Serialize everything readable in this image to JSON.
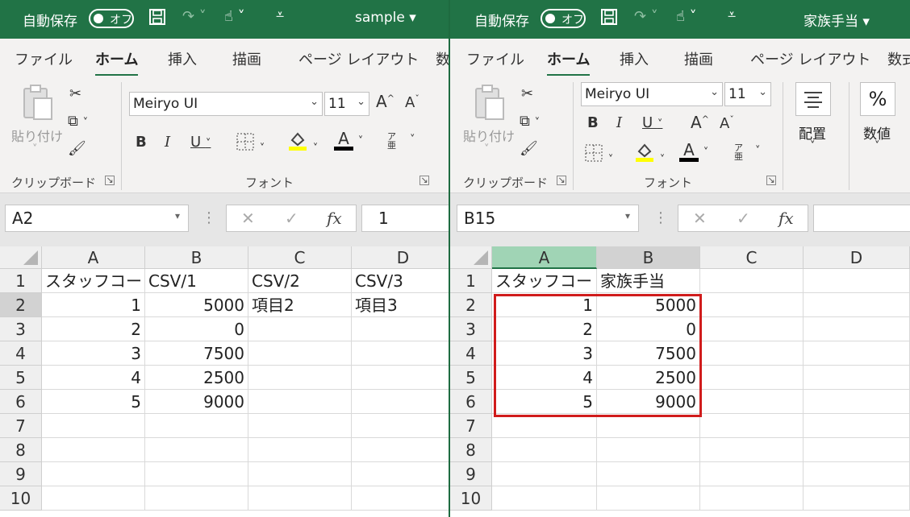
{
  "window1": {
    "autosave_label": "自動保存",
    "autosave_state": "オフ",
    "doc_title": "sample",
    "tabs": [
      "ファイル",
      "ホーム",
      "挿入",
      "描画",
      "ページ レイアウト",
      "数"
    ],
    "clipboard": {
      "paste_label": "貼り付け",
      "group_label": "クリップボード"
    },
    "font": {
      "name": "Meiryo UI",
      "size": "11",
      "group_label": "フォント"
    },
    "name_box": "A2",
    "formula_value": "1",
    "columns": [
      "A",
      "B",
      "C",
      "D"
    ],
    "row_numbers": [
      "1",
      "2",
      "3",
      "4",
      "5",
      "6",
      "7",
      "8",
      "9",
      "10"
    ],
    "rows": [
      [
        "スタッフコード",
        "CSV/1",
        "CSV/2",
        "CSV/3"
      ],
      [
        "1",
        "5000",
        "項目2",
        "項目3"
      ],
      [
        "2",
        "0",
        "",
        ""
      ],
      [
        "3",
        "7500",
        "",
        ""
      ],
      [
        "4",
        "2500",
        "",
        ""
      ],
      [
        "5",
        "9000",
        "",
        ""
      ]
    ]
  },
  "window2": {
    "autosave_label": "自動保存",
    "autosave_state": "オフ",
    "doc_title": "家族手当",
    "tabs": [
      "ファイル",
      "ホーム",
      "挿入",
      "描画",
      "ページ レイアウト",
      "数式"
    ],
    "clipboard": {
      "paste_label": "貼り付け",
      "group_label": "クリップボード"
    },
    "font": {
      "name": "Meiryo UI",
      "size": "11",
      "group_label": "フォント"
    },
    "alignment_label": "配置",
    "number_label": "数値",
    "name_box": "B15",
    "columns": [
      "A",
      "B",
      "C",
      "D"
    ],
    "row_numbers": [
      "1",
      "2",
      "3",
      "4",
      "5",
      "6",
      "7",
      "8",
      "9",
      "10"
    ],
    "rows": [
      [
        "スタッフコード",
        "家族手当",
        "",
        ""
      ],
      [
        "1",
        "5000",
        "",
        ""
      ],
      [
        "2",
        "0",
        "",
        ""
      ],
      [
        "3",
        "7500",
        "",
        ""
      ],
      [
        "4",
        "2500",
        "",
        ""
      ],
      [
        "5",
        "9000",
        "",
        ""
      ]
    ]
  },
  "icons": {
    "save": "save-icon",
    "redo": "redo-icon",
    "touch": "touch-mode-icon",
    "customize": "customize-qat-icon",
    "cut": "scissors-icon",
    "copy": "copy-icon",
    "format_painter": "format-painter-icon",
    "bold": "B",
    "italic": "I",
    "underline": "U",
    "grow_font": "A^",
    "shrink_font": "Aˇ",
    "borders": "borders-icon",
    "fill_color": "fill-color-icon",
    "font_color": "A",
    "phonetic": "ア亜",
    "cancel": "✕",
    "enter": "✓",
    "fx": "fx"
  },
  "colors": {
    "accent": "#217346",
    "highlight_border": "#d01c1c",
    "fill_yellow": "#ffff00"
  }
}
